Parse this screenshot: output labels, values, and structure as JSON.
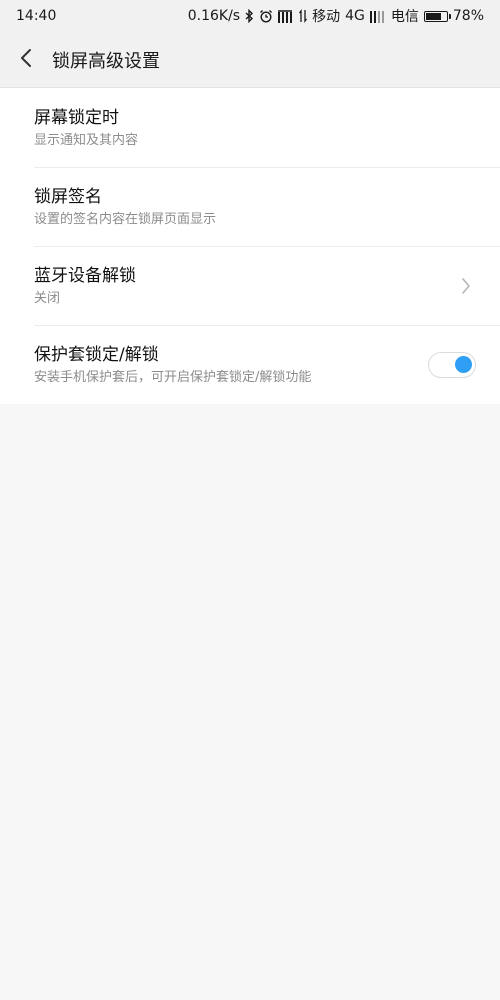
{
  "status_bar": {
    "time": "14:40",
    "net_speed": "0.16K/s",
    "carrier1": "移动",
    "network1": "4G",
    "carrier2": "电信",
    "battery_percent": "78%",
    "battery_level": 0.78,
    "icons": [
      "bluetooth-icon",
      "alarm-icon",
      "signal-icon",
      "data-arrows-icon",
      "signal-icon"
    ]
  },
  "header": {
    "title": "锁屏高级设置",
    "back_icon": "chevron-left-icon"
  },
  "settings": [
    {
      "title": "屏幕锁定时",
      "subtitle": "显示通知及其内容"
    },
    {
      "title": "锁屏签名",
      "subtitle": "设置的签名内容在锁屏页面显示"
    },
    {
      "title": "蓝牙设备解锁",
      "subtitle": "关闭",
      "control": "chevron-right-icon"
    },
    {
      "title": "保护套锁定/解锁",
      "subtitle": "安装手机保护套后，可开启保护套锁定/解锁功能",
      "control": "toggle",
      "enabled": true
    }
  ],
  "colors": {
    "accent": "#2f9ff5",
    "background": "#f7f7f7",
    "card": "#ffffff",
    "header": "#f1f1f1"
  }
}
